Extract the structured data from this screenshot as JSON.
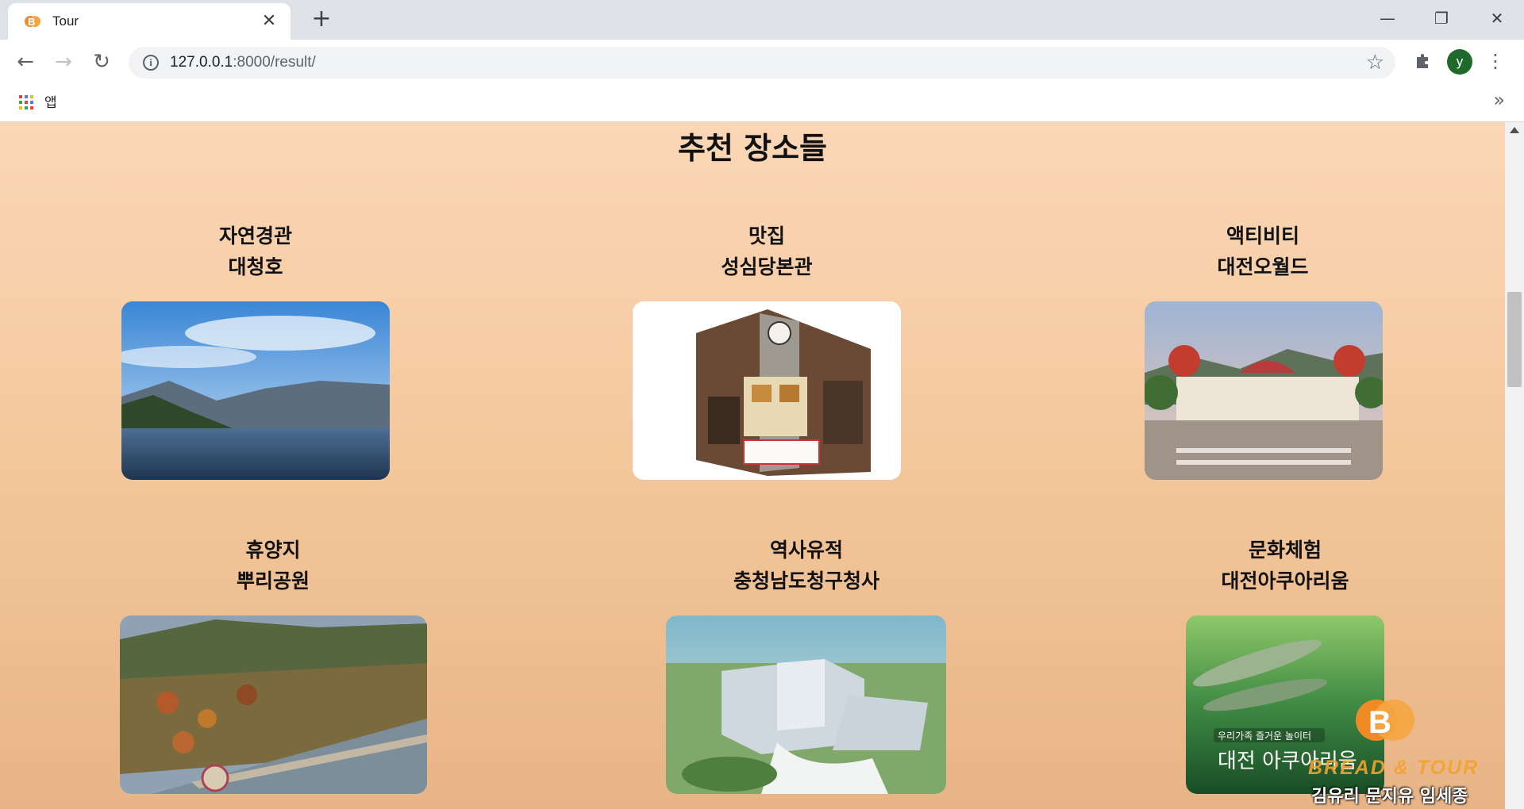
{
  "browser": {
    "tab_title": "Tour",
    "url_host": "127.0.0.1",
    "url_rest": ":8000/result/",
    "bookmarks": {
      "apps_label": "앱"
    },
    "profile_initial": "y"
  },
  "page": {
    "heading": "추천 장소들",
    "cards": [
      {
        "category": "자연경관",
        "name": "대청호",
        "image": "lake-photo"
      },
      {
        "category": "맛집",
        "name": "성심당본관",
        "image": "bakery-building-photo"
      },
      {
        "category": "액티비티",
        "name": "대전오월드",
        "image": "theme-park-photo"
      },
      {
        "category": "휴양지",
        "name": "뿌리공원",
        "image": "park-aerial-photo"
      },
      {
        "category": "역사유적",
        "name": "충청남도청구청사",
        "image": "government-building-photo"
      },
      {
        "category": "문화체험",
        "name": "대전아쿠아리움",
        "image": "aquarium-poster"
      }
    ],
    "aquarium_poster": {
      "tagline": "우리가족 즐거운 놀이터",
      "title": "대전 아쿠아리움"
    },
    "logo": {
      "brand": "BREAD & TOUR",
      "authors": "김유리 문지유 임세종"
    }
  },
  "colors": {
    "background_top": "#fbd7b7",
    "background_bottom": "#e8b486",
    "logo_orange": "#f5a22c"
  }
}
